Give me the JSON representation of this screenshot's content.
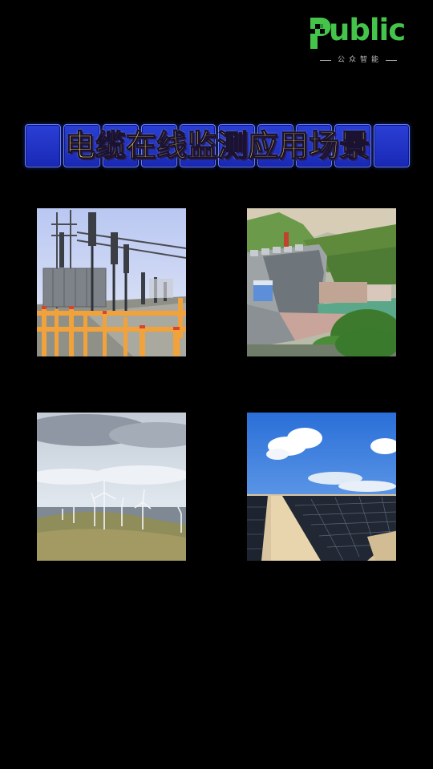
{
  "logo": {
    "wordmark": "ublic",
    "subtitle": "公众智能"
  },
  "banner": {
    "title": "电缆在线监测应用场景"
  },
  "scenarios": [
    {
      "icon": "substation-photo"
    },
    {
      "icon": "hydropower-dam-photo"
    },
    {
      "icon": "wind-farm-photo"
    },
    {
      "icon": "solar-farm-photo"
    }
  ],
  "colors": {
    "background": "#000000",
    "logo_green": "#44c44a",
    "banner_blue": "#1f31c4",
    "banner_text_yellow": "#ffe84a"
  }
}
